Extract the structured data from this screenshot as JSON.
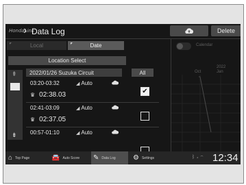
{
  "header": {
    "brand": "HondaLink",
    "title": "Data Log",
    "delete_label": "Delete"
  },
  "tabs": {
    "local_label": "Local",
    "date_label": "Date"
  },
  "location_select_label": "Location Select",
  "group": {
    "label": "2022/01/26  Suzuka Circuit",
    "all_label": "All"
  },
  "entries": [
    {
      "time": "03:20-03:32",
      "mode": "Auto",
      "lap": "02:38.03",
      "checked": true
    },
    {
      "time": "02:41-03:09",
      "mode": "Auto",
      "lap": "02:37.05",
      "checked": false
    },
    {
      "time": "00:57-01:10",
      "mode": "Auto",
      "lap": "",
      "checked": false
    }
  ],
  "calendar": {
    "label": "Calendar",
    "year": "2022",
    "month_left": "Oct",
    "month_right": "Jan"
  },
  "nav": {
    "items": [
      {
        "label": "Top Page",
        "icon": "home-icon"
      },
      {
        "label": "Auto Score",
        "icon": "car-icon"
      },
      {
        "label": "Data Log",
        "icon": "data-log-icon"
      },
      {
        "label": "Settings",
        "icon": "gear-icon"
      }
    ]
  },
  "status": {
    "clock": "12:34",
    "icons": [
      "bluetooth-icon",
      "signal-icon",
      "wifi-icon"
    ]
  },
  "colors": {
    "screen_bg": "#161616",
    "button_bg": "#4a4a4a",
    "active_tab": "#5a5a5a",
    "text": "#e6e6e6"
  }
}
